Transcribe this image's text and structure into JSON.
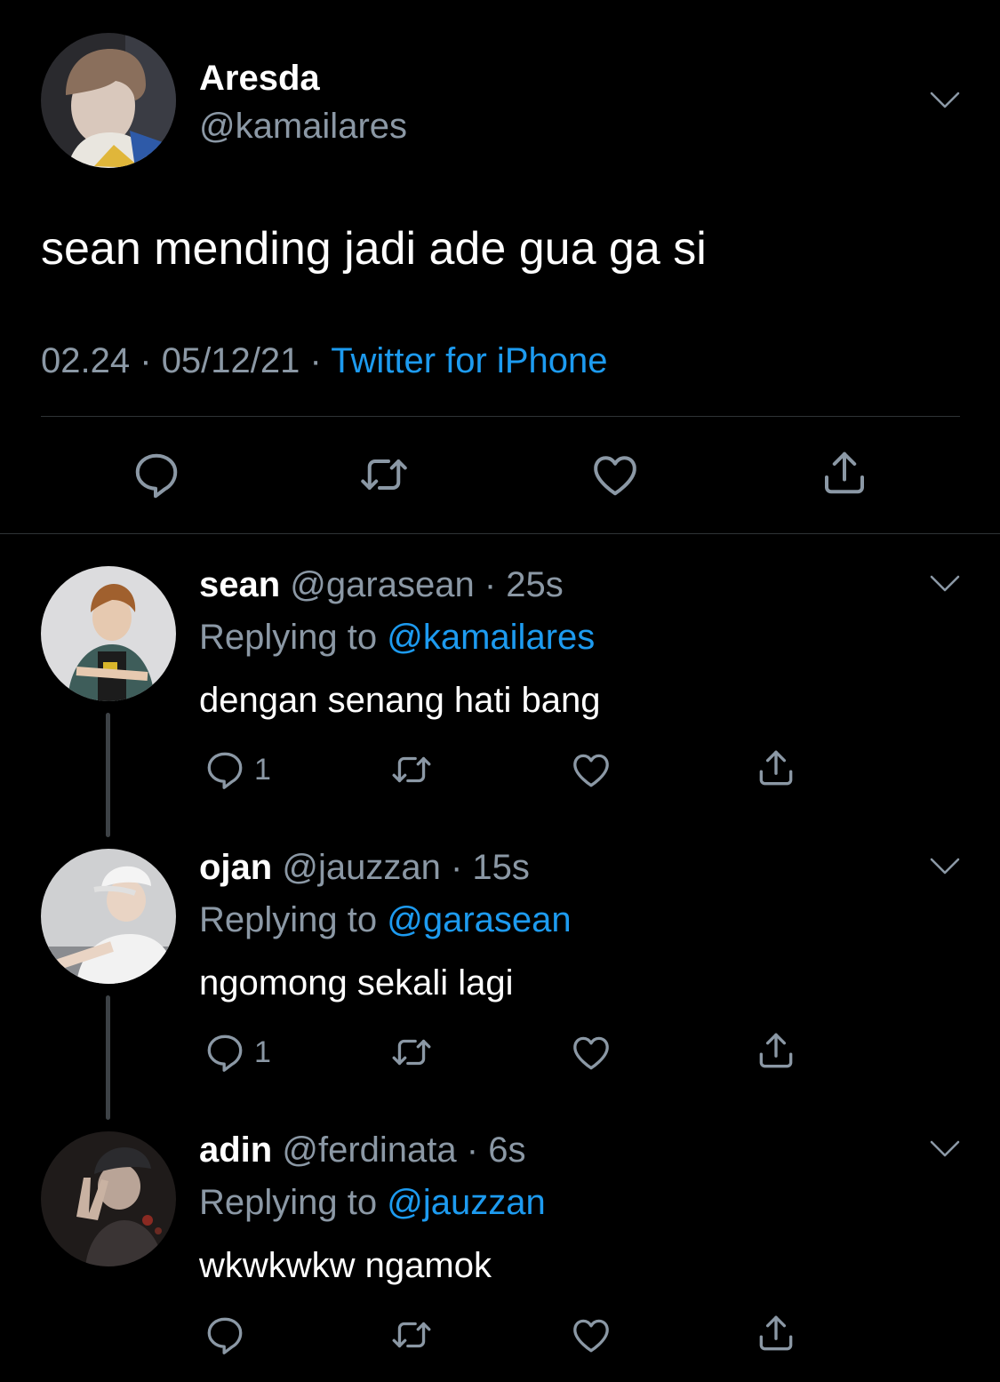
{
  "tweet": {
    "name": "Aresda",
    "handle": "@kamailares",
    "text": "sean mending jadi ade gua ga si",
    "time": "02.24",
    "date": "05/12/21",
    "source": "Twitter for iPhone",
    "separator": "·"
  },
  "replies": [
    {
      "name": "sean",
      "handle": "@garasean",
      "age": "25s",
      "replying_label": "Replying to",
      "replying_to": "@kamailares",
      "text": "dengan senang hati bang",
      "reply_count": "1"
    },
    {
      "name": "ojan",
      "handle": "@jauzzan",
      "age": "15s",
      "replying_label": "Replying to",
      "replying_to": "@garasean",
      "text": "ngomong sekali lagi",
      "reply_count": "1"
    },
    {
      "name": "adin",
      "handle": "@ferdinata",
      "age": "6s",
      "replying_label": "Replying to",
      "replying_to": "@jauzzan",
      "text": "wkwkwkw ngamok",
      "reply_count": ""
    }
  ],
  "colors": {
    "background": "#000000",
    "secondary_text": "#8b98a5",
    "link": "#1d9bf0",
    "divider": "#2f3336"
  },
  "icons": [
    "reply-icon",
    "retweet-icon",
    "like-icon",
    "share-icon",
    "chevron-down-icon"
  ]
}
